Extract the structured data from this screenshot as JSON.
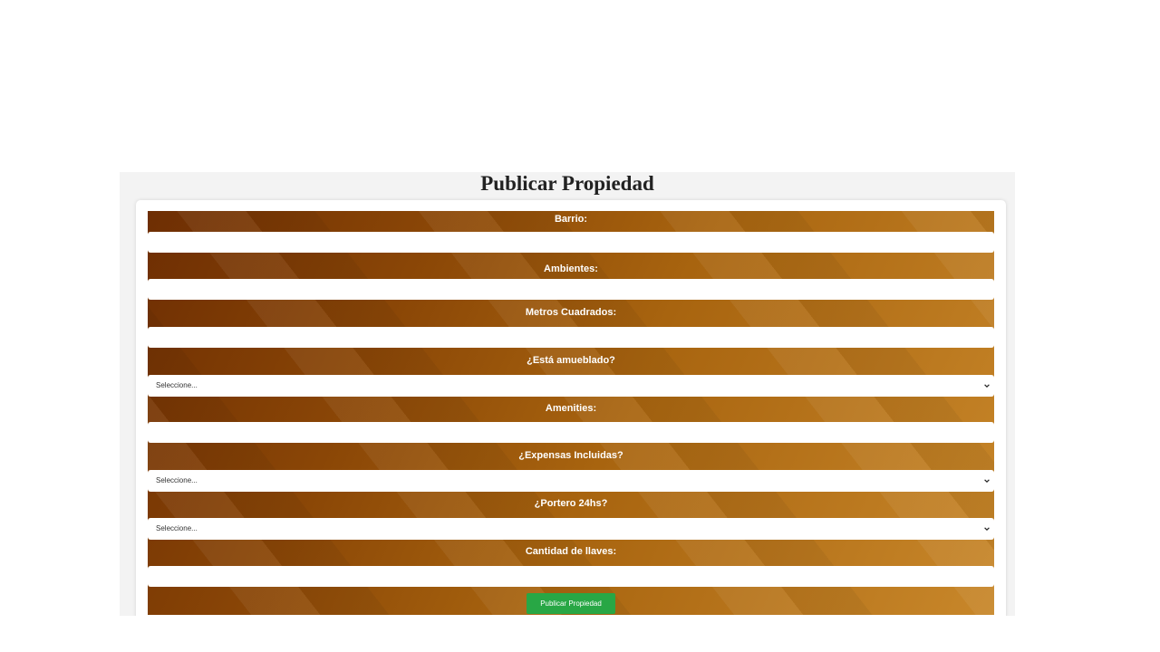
{
  "page": {
    "title": "Publicar Propiedad"
  },
  "form": {
    "fields": [
      {
        "label": "Barrio:",
        "type": "text",
        "value": ""
      },
      {
        "label": "Ambientes:",
        "type": "text",
        "value": ""
      },
      {
        "label": "Metros Cuadrados:",
        "type": "text",
        "value": ""
      },
      {
        "label": "¿Está amueblado?",
        "type": "select",
        "value": "Seleccione..."
      },
      {
        "label": "Amenities:",
        "type": "text",
        "value": ""
      },
      {
        "label": "¿Expensas Incluidas?",
        "type": "select",
        "value": "Seleccione..."
      },
      {
        "label": "¿Portero 24hs?",
        "type": "select",
        "value": "Seleccione..."
      },
      {
        "label": "Cantidad de llaves:",
        "type": "text",
        "value": ""
      }
    ],
    "submit_label": "Publicar Propiedad"
  },
  "colors": {
    "background_gradient": [
      "#6e2e03",
      "#8a4606",
      "#a8640f",
      "#c8872a"
    ],
    "submit_button": "#28a745",
    "panel": "#f3f3f3"
  },
  "icons": {
    "select_arrow": "chevron-down-icon"
  }
}
